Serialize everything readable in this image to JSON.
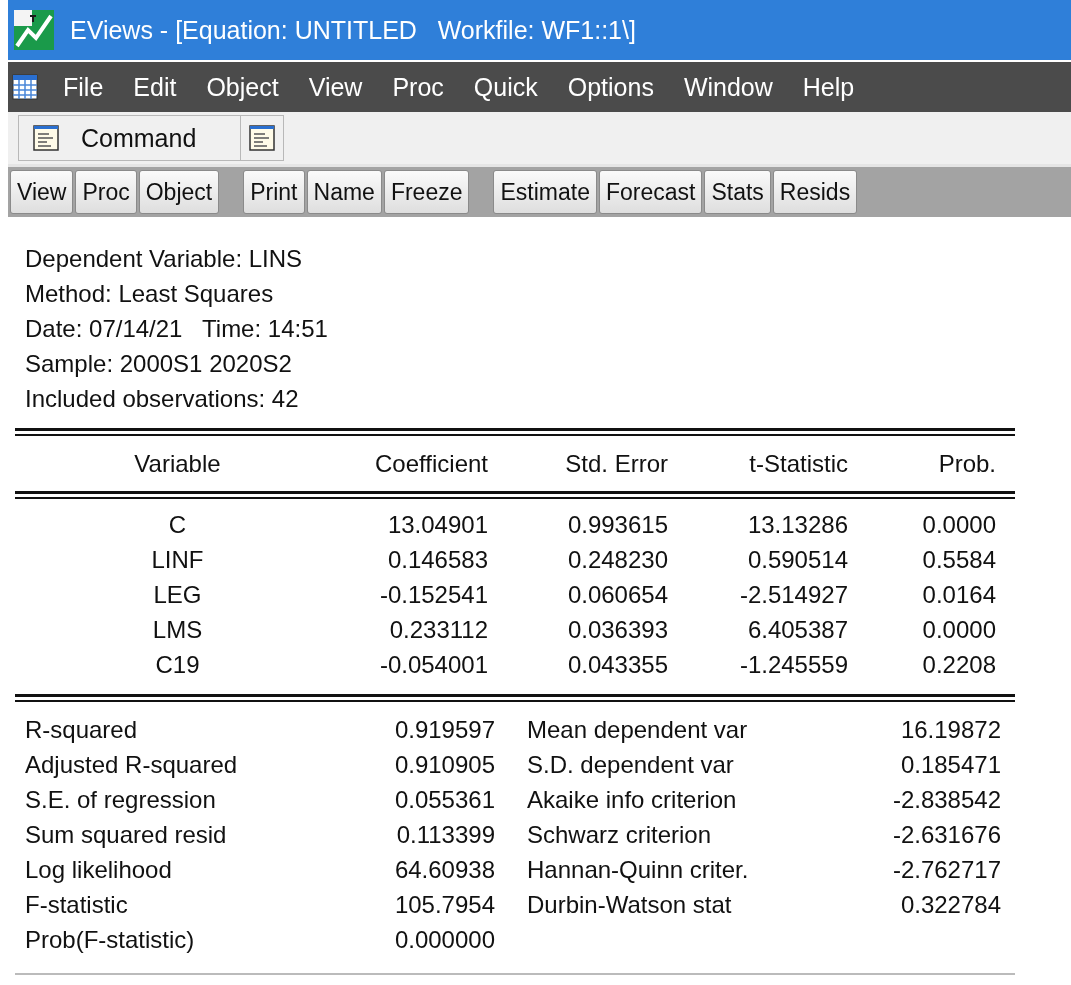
{
  "window": {
    "title": "EViews - [Equation: UNTITLED   Workfile: WF1::1\\]"
  },
  "menu": [
    "File",
    "Edit",
    "Object",
    "View",
    "Proc",
    "Quick",
    "Options",
    "Window",
    "Help"
  ],
  "command_bar": {
    "label": "Command"
  },
  "toolbar": [
    [
      "View",
      "Proc",
      "Object"
    ],
    [
      "Print",
      "Name",
      "Freeze"
    ],
    [
      "Estimate",
      "Forecast",
      "Stats",
      "Resids"
    ]
  ],
  "header": [
    "Dependent Variable: LINS",
    "Method: Least Squares",
    "Date: 07/14/21   Time: 14:51",
    "Sample: 2000S1 2020S2",
    "Included observations: 42"
  ],
  "table": {
    "columns": [
      "Variable",
      "Coefficient",
      "Std. Error",
      "t-Statistic",
      "Prob."
    ],
    "rows": [
      [
        "C",
        "13.04901",
        "0.993615",
        "13.13286",
        "0.0000"
      ],
      [
        "LINF",
        "0.146583",
        "0.248230",
        "0.590514",
        "0.5584"
      ],
      [
        "LEG",
        "-0.152541",
        "0.060654",
        "-2.514927",
        "0.0164"
      ],
      [
        "LMS",
        "0.233112",
        "0.036393",
        "6.405387",
        "0.0000"
      ],
      [
        "C19",
        "-0.054001",
        "0.043355",
        "-1.245559",
        "0.2208"
      ]
    ]
  },
  "statistics": [
    {
      "label": "R-squared",
      "value": "0.919597",
      "label_2": "Mean dependent var",
      "value_2": "16.19872"
    },
    {
      "label": "Adjusted R-squared",
      "value": "0.910905",
      "label_2": "S.D. dependent var",
      "value_2": "0.185471"
    },
    {
      "label": "S.E. of regression",
      "value": "0.055361",
      "label_2": "Akaike info criterion",
      "value_2": "-2.838542"
    },
    {
      "label": "Sum squared resid",
      "value": "0.113399",
      "label_2": "Schwarz criterion",
      "value_2": "-2.631676"
    },
    {
      "label": "Log likelihood",
      "value": "64.60938",
      "label_2": "Hannan-Quinn criter.",
      "value_2": "-2.762717"
    },
    {
      "label": "F-statistic",
      "value": "105.7954",
      "label_2": "Durbin-Watson stat",
      "value_2": "0.322784"
    },
    {
      "label": "Prob(F-statistic)",
      "value": "0.000000"
    }
  ]
}
